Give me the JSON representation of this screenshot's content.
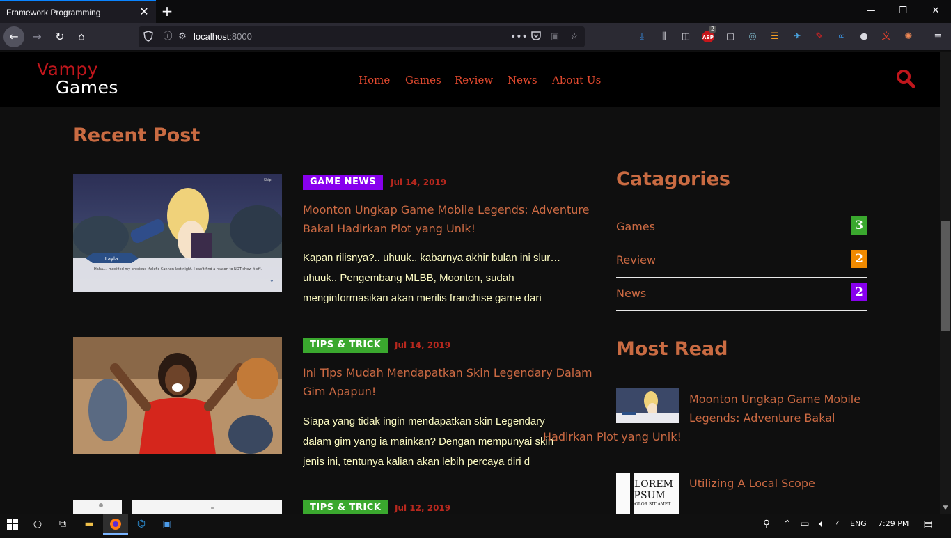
{
  "browser": {
    "tab_title": "Framework Programming",
    "url_host": "localhost",
    "url_port": ":8000",
    "toolbar_badges": {
      "abp": "2"
    }
  },
  "site": {
    "logo_top": "Vampy",
    "logo_bottom": "Games",
    "menu": [
      "Home",
      "Games",
      "Review",
      "News",
      "About Us"
    ],
    "brand_color": "#c0161c",
    "accent_color": "#cc6a43"
  },
  "recent": {
    "title": "Recent Post",
    "posts": [
      {
        "category": "GAME NEWS",
        "category_color": "#8800ee",
        "date": "Jul 14, 2019",
        "title_lines": [
          "Moonton Ungkap Game Mobile Legends: Adventure",
          "Bakal Hadirkan Plot yang Unik!"
        ],
        "excerpt_lines": [
          "Kapan rilisnya?.. uhuuk.. kabarnya akhir bulan ini slur…",
          "uhuuk.. Pengembang MLBB, Moonton, sudah",
          "menginformasikan akan merilis franchise game dari"
        ],
        "thumb_caption": "Layla",
        "thumb_dialog": "Haha...I modified my precious Malefic Cannon last night. I can't find a reason to NOT show it off.",
        "thumb_skip": "Skip"
      },
      {
        "category": "TIPS & TRICK",
        "category_color": "#3aa82e",
        "date": "Jul 14, 2019",
        "title_lines": [
          "Ini Tips Mudah Mendapatkan Skin Legendary Dalam",
          "Gim Apapun!"
        ],
        "excerpt_lines": [
          "Siapa yang tidak ingin mendapatkan skin Legendary",
          "dalam gim yang ia mainkan? Dengan mempunyai skin",
          "jenis ini, tentunya kalian akan lebih percaya diri d"
        ]
      },
      {
        "category": "TIPS & TRICK",
        "category_color": "#3aa82e",
        "date": "Jul 12, 2019"
      }
    ]
  },
  "sidebar": {
    "categories_title": "Catagories",
    "categories": [
      {
        "label": "Games",
        "count": "3",
        "color": "#3aa82e"
      },
      {
        "label": "Review",
        "count": "2",
        "color": "#f08a00"
      },
      {
        "label": "News",
        "count": "2",
        "color": "#8800ee"
      }
    ],
    "most_read_title": "Most Read",
    "most_read": [
      {
        "title_lines": [
          "Moonton Ungkap Game Mobile",
          "Legends: Adventure Bakal",
          "Hadirkan Plot yang Unik!"
        ]
      },
      {
        "title_lines": [
          "Utilizing A Local Scope"
        ],
        "thumb_text": [
          "LOREM",
          "IPSUM",
          "DOLOR SIT AMET"
        ]
      }
    ]
  },
  "taskbar": {
    "lang": "ENG",
    "time": "7:29 PM"
  }
}
